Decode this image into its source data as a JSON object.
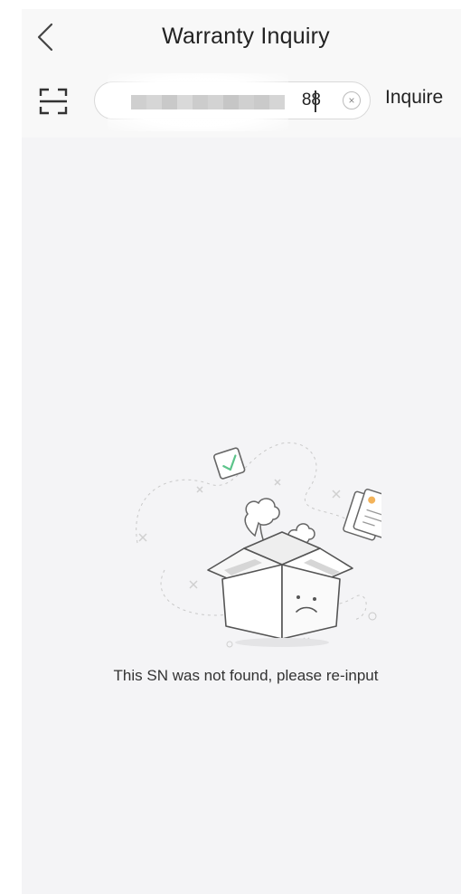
{
  "header": {
    "back_icon": "chevron-left-icon",
    "title": "Warranty Inquiry"
  },
  "search": {
    "scan_icon": "scan-frame-icon",
    "value": "88",
    "clear_icon": "close-icon",
    "clear_glyph": "×",
    "inquire_label": "Inquire"
  },
  "empty_state": {
    "illustration_icon": "empty-box-icon",
    "message": "This SN was not found, please re-input"
  },
  "colors": {
    "background": "#f4f4f6",
    "header_bg": "#f8f8f8",
    "text": "#222222",
    "accent_green": "#5cc48a",
    "accent_orange": "#f3b35a"
  }
}
